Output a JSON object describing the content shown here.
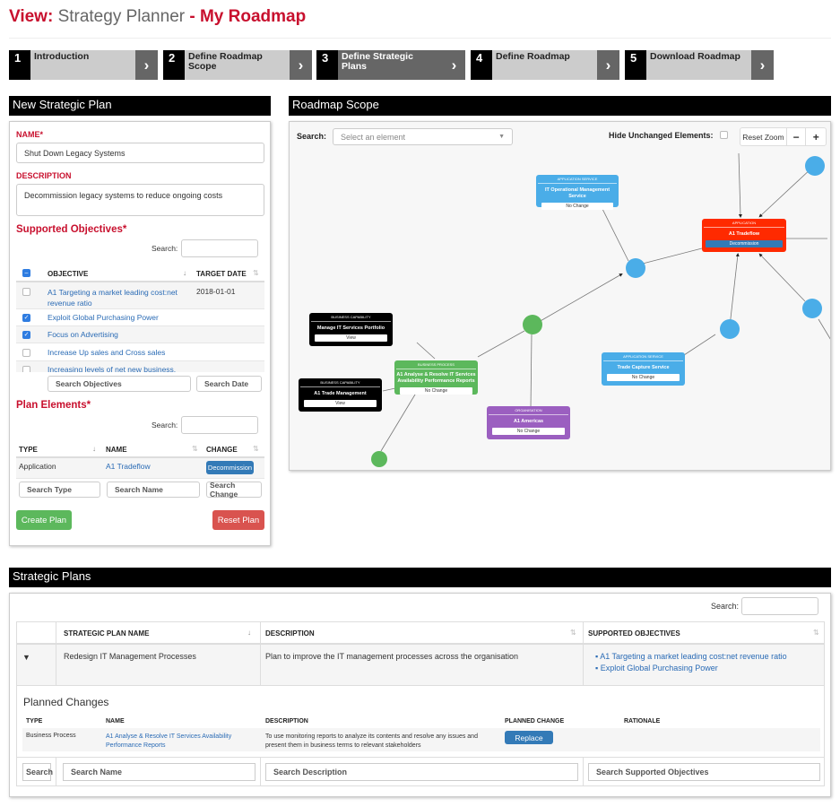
{
  "page": {
    "view_label": "View:",
    "app": "Strategy Planner",
    "sep": " - ",
    "roadmap": "My Roadmap"
  },
  "steps": [
    {
      "num": "1",
      "label": "Introduction",
      "active": false
    },
    {
      "num": "2",
      "label": "Define Roadmap Scope",
      "active": false
    },
    {
      "num": "3",
      "label": "Define Strategic Plans",
      "active": true
    },
    {
      "num": "4",
      "label": "Define Roadmap",
      "active": false
    },
    {
      "num": "5",
      "label": "Download Roadmap",
      "active": false
    }
  ],
  "step_arrow": "›",
  "new_plan": {
    "title": "New Strategic Plan",
    "name_label": "NAME*",
    "name_value": "Shut Down Legacy Systems",
    "desc_label": "DESCRIPTION",
    "desc_value": "Decommission legacy systems to reduce ongoing costs",
    "objectives_title": "Supported Objectives*",
    "search_label": "Search:",
    "obj_headers": {
      "objective": "OBJECTIVE",
      "target_date": "TARGET DATE"
    },
    "objectives": [
      {
        "name": "A1 Targeting a market leading cost:net revenue ratio",
        "date": "2018-01-01",
        "checked": false
      },
      {
        "name": "Exploit Global Purchasing Power",
        "date": "",
        "checked": true
      },
      {
        "name": "Focus on Advertising",
        "date": "",
        "checked": true
      },
      {
        "name": "Increase Up sales and Cross sales",
        "date": "",
        "checked": false
      },
      {
        "name": "Increasing levels of net new business.",
        "date": "",
        "checked": false
      }
    ],
    "obj_search_ph": "Search Objectives",
    "date_search_ph": "Search Date",
    "elements_title": "Plan Elements*",
    "el_headers": {
      "type": "TYPE",
      "name": "NAME",
      "change": "CHANGE"
    },
    "elements": [
      {
        "type": "Application",
        "name": "A1 Tradeflow",
        "change": "Decommission"
      }
    ],
    "type_ph": "Search Type",
    "name_ph": "Search Name",
    "change_ph": "Search Change",
    "create_btn": "Create Plan",
    "reset_btn": "Reset Plan"
  },
  "scope": {
    "title": "Roadmap Scope",
    "search_label": "Search:",
    "search_ph": "Select an element",
    "hide_label": "Hide Unchanged Elements:",
    "reset_zoom": "Reset Zoom",
    "zoom_out": "−",
    "zoom_in": "+",
    "nodes": {
      "itops": {
        "type": "APPLICATION SERVICE",
        "name": "IT Operational Management Service",
        "status": "No Change",
        "color": "#4aade8"
      },
      "tradeflow": {
        "type": "APPLICATION",
        "name": "A1 Tradeflow",
        "status": "Decommission",
        "color": "#ff2a00"
      },
      "manage": {
        "type": "BUSINESS CAPABILITY",
        "name": "Manage IT Services Portfolio",
        "status": "View",
        "color": "#000000"
      },
      "trademgmt": {
        "type": "BUSINESS CAPABILITY",
        "name": "A1 Trade Management",
        "status": "View",
        "color": "#000000"
      },
      "process": {
        "type": "BUSINESS PROCESS",
        "name": "A1 Analyse & Resolve IT Services Availability Performance Reports",
        "status": "No Change",
        "color": "#5cb85c"
      },
      "americas": {
        "type": "ORGANISATION",
        "name": "A1 Americas",
        "status": "No Change",
        "color": "#9b5fc0"
      },
      "capture": {
        "type": "APPLICATION SERVICE",
        "name": "Trade Capture Service",
        "status": "No Change",
        "color": "#4aade8"
      }
    }
  },
  "plans": {
    "title": "Strategic Plans",
    "search_label": "Search:",
    "headers": {
      "name": "STRATEGIC PLAN NAME",
      "description": "DESCRIPTION",
      "objectives": "SUPPORTED OBJECTIVES"
    },
    "rows": [
      {
        "name": "Redesign IT Management Processes",
        "description": "Plan to improve the IT management processes across the organisation",
        "objectives": [
          "A1 Targeting a market leading cost:net revenue ratio",
          "Exploit Global Purchasing Power"
        ]
      }
    ],
    "planned_changes": {
      "title": "Planned Changes",
      "headers": {
        "type": "TYPE",
        "name": "NAME",
        "description": "DESCRIPTION",
        "change": "PLANNED CHANGE",
        "rationale": "RATIONALE"
      },
      "rows": [
        {
          "type": "Business Process",
          "name": "A1 Analyse & Resolve IT Services Availability Performance Reports",
          "description": "To use monitoring reports to analyze its contents and resolve any issues and present them in business terms to relevant stakeholders",
          "change": "Replace",
          "rationale": ""
        }
      ]
    },
    "filters": {
      "col0": "Search",
      "name": "Search Name",
      "description": "Search Description",
      "objectives": "Search Supported Objectives"
    }
  }
}
